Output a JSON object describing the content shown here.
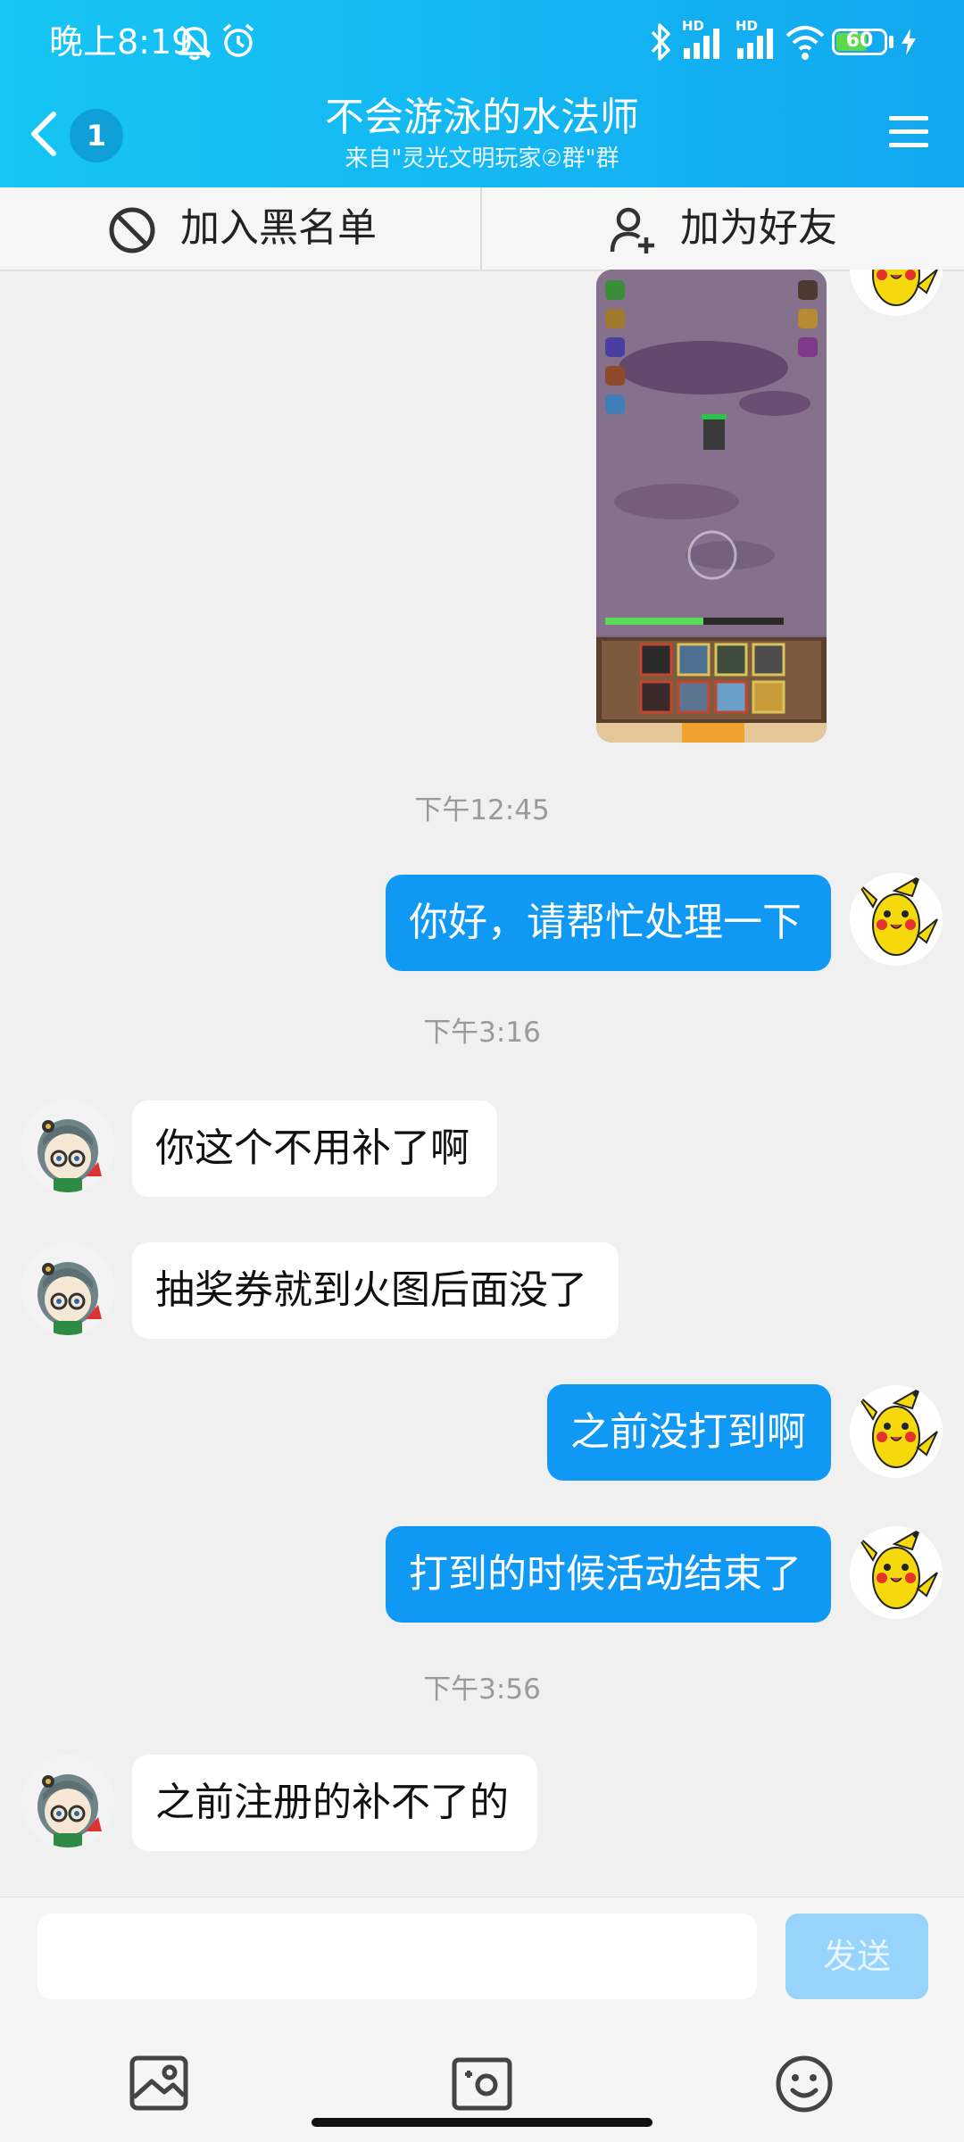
{
  "status": {
    "time": "晚上8:19",
    "battery": "60",
    "signal_label_1": "HD",
    "signal_label_2": "HD"
  },
  "header": {
    "unread_count": "1",
    "title": "不会游泳的水法师",
    "subtitle": "来自\"灵光文明玩家②群\"群"
  },
  "actions": {
    "block_label": "加入黑名单",
    "add_friend_label": "加为好友"
  },
  "messages": [
    {
      "type": "image",
      "from": "me"
    },
    {
      "type": "time",
      "text": "下午12:45"
    },
    {
      "type": "text",
      "from": "me",
      "text": "你好，请帮忙处理一下"
    },
    {
      "type": "time",
      "text": "下午3:16"
    },
    {
      "type": "text",
      "from": "other",
      "text": "你这个不用补了啊"
    },
    {
      "type": "text",
      "from": "other",
      "text": "抽奖券就到火图后面没了"
    },
    {
      "type": "text",
      "from": "me",
      "text": "之前没打到啊"
    },
    {
      "type": "text",
      "from": "me",
      "text": "打到的时候活动结束了"
    },
    {
      "type": "time",
      "text": "下午3:56"
    },
    {
      "type": "text",
      "from": "other",
      "text": "之前注册的补不了的"
    }
  ],
  "composer": {
    "placeholder": "",
    "send_label": "发送"
  },
  "colors": {
    "header_blue": "#14b9f3",
    "my_bubble": "#0f99f5",
    "send_disabled": "#97d4fb"
  },
  "icons": [
    "back-chevron-icon",
    "menu-icon",
    "block-icon",
    "add-user-icon",
    "image-icon",
    "camera-icon",
    "emoji-icon"
  ]
}
